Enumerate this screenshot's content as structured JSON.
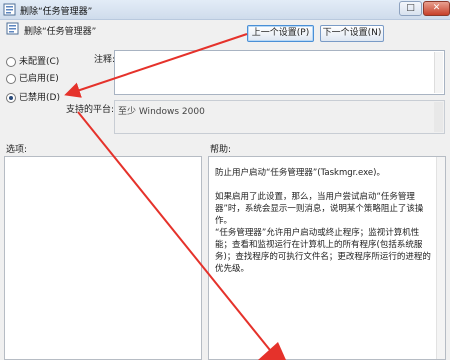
{
  "window": {
    "title": "删除“任务管理器”"
  },
  "header": {
    "title": "删除“任务管理器”",
    "prev_label": "上一个设置(P)",
    "next_label": "下一个设置(N)"
  },
  "options": {
    "not_configured": "未配置(C)",
    "enabled": "已启用(E)",
    "disabled": "已禁用(D)",
    "selected": "disabled"
  },
  "comment": {
    "label": "注释:",
    "value": ""
  },
  "platform": {
    "label": "支持的平台:",
    "value": "至少 Windows 2000"
  },
  "lower": {
    "options_label": "选项:",
    "help_label": "帮助:",
    "help_paragraphs": [
      "防止用户启动“任务管理器”(Taskmgr.exe)。",
      "如果启用了此设置，那么，当用户尝试启动“任务管理器”时，系统会显示一则消息，说明某个策略阻止了该操作。",
      "“任务管理器”允许用户启动或终止程序；监视计算机性能；查看和监视运行在计算机上的所有程序(包括系统服务)；查找程序的可执行文件名；更改程序所运行的进程的优先级。"
    ]
  },
  "annotation": {
    "arrow_color": "#e5322b"
  }
}
